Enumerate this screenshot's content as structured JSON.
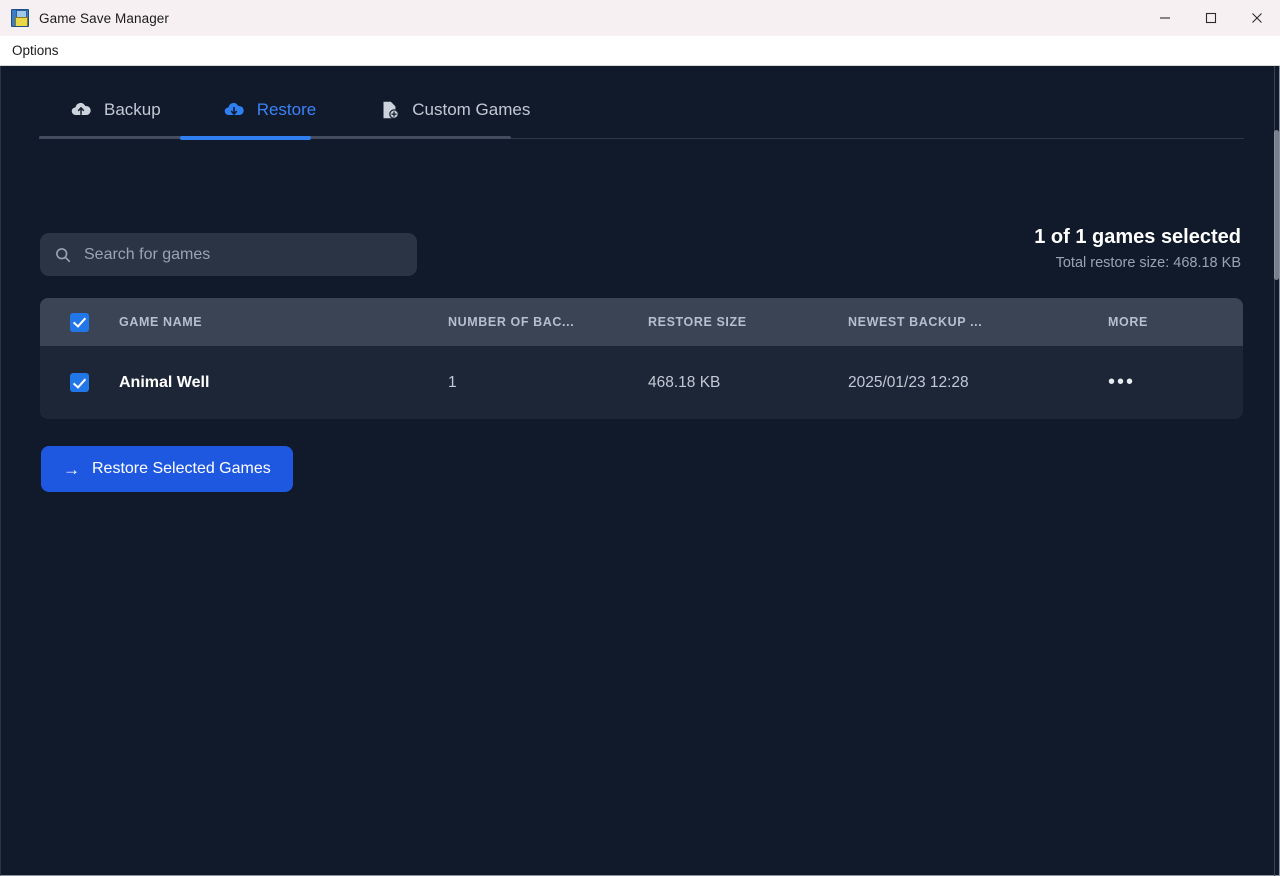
{
  "window": {
    "title": "Game Save Manager",
    "icon": "floppy-disk-icon",
    "controls": {
      "minimize": "minimize-button",
      "maximize": "maximize-button",
      "close": "close-button"
    }
  },
  "menubar": {
    "items": [
      {
        "label": "Options"
      }
    ]
  },
  "tabs": [
    {
      "label": "Backup",
      "icon": "cloud-upload-icon",
      "active": false
    },
    {
      "label": "Restore",
      "icon": "cloud-download-icon",
      "active": true
    },
    {
      "label": "Custom Games",
      "icon": "file-plus-icon",
      "active": false
    }
  ],
  "search": {
    "placeholder": "Search for games",
    "value": "",
    "icon": "search-icon"
  },
  "stats": {
    "selected_text": "1 of 1 games selected",
    "total_size_text": "Total restore size: 468.18 KB"
  },
  "table": {
    "select_all_checked": true,
    "columns": [
      {
        "key": "check",
        "label": ""
      },
      {
        "key": "name",
        "label": "GAME NAME"
      },
      {
        "key": "num",
        "label": "NUMBER OF BAC..."
      },
      {
        "key": "size",
        "label": "RESTORE SIZE"
      },
      {
        "key": "date",
        "label": "NEWEST BACKUP ..."
      },
      {
        "key": "more",
        "label": "MORE"
      }
    ],
    "rows": [
      {
        "checked": true,
        "name": "Animal Well",
        "num": "1",
        "size": "468.18 KB",
        "date": "2025/01/23 12:28",
        "more": "•••"
      }
    ]
  },
  "actions": {
    "restore_label": "Restore Selected Games",
    "restore_arrow": "→"
  },
  "colors": {
    "accent_blue": "#2f7ff0",
    "button_blue": "#1f58e0",
    "checkbox_blue": "#2176e8",
    "app_bg": "#111a2b",
    "table_header": "#3a4455",
    "table_row": "#1d2636",
    "titlebar_bg": "#f7f0f2"
  }
}
